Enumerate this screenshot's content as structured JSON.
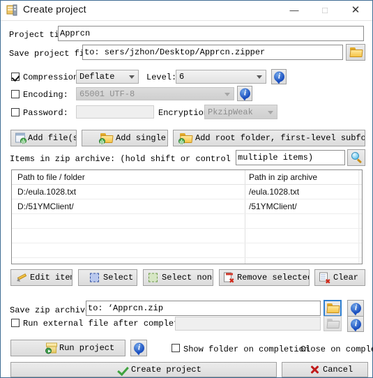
{
  "window": {
    "title": "Create project",
    "app_icon": "zip-app-icon",
    "minimize_label": "—",
    "maximize_label": "□",
    "close_label": "✕"
  },
  "project": {
    "title_label": "Project tit",
    "title_label_full": "Project title:",
    "title_value": "Apprcn",
    "save_file_label": "Save project file",
    "save_file_value": "to: sers/jzhon/Desktop/Apprcn.zipper",
    "browse_icon": "folder-icon"
  },
  "options": {
    "compression_label": "Compression:",
    "compression_checked": true,
    "compression_value": "Deflate",
    "level_label": "Level:",
    "level_value": "6",
    "encoding_label": "Encoding:",
    "encoding_checked": false,
    "encoding_value": "65001 UTF-8",
    "password_label": "Password:",
    "password_checked": false,
    "password_value": "",
    "encryption_label": "Encryption:",
    "encryption_value": "PkzipWeak",
    "info_icon": "info-icon"
  },
  "add_buttons": {
    "add_files": "Add file(s)",
    "add_single": "Add single",
    "add_root_folder": "Add root folder, first-level subfolders"
  },
  "items": {
    "label": "Items in zip archive: (hold shift or control to select",
    "filter_value": "multiple items)",
    "search_icon": "magnifier-icon",
    "columns": [
      "Path to file / folder",
      "Path in zip archive"
    ],
    "rows": [
      [
        "D:/eula.1028.txt",
        "/eula.1028.txt"
      ],
      [
        "D:/51YMClient/",
        "/51YMClient/"
      ],
      [
        "",
        ""
      ],
      [
        "",
        ""
      ],
      [
        "",
        ""
      ],
      [
        "",
        ""
      ]
    ]
  },
  "list_actions": {
    "edit_item": "Edit item",
    "select": "Select",
    "select_none": "Select none",
    "remove_selected": "Remove selected",
    "clear": "Clear"
  },
  "output": {
    "save_zip_label": "Save zip archive",
    "save_zip_value": "to: ‘Apprcn.zip",
    "run_external_label": "Run external file after completion:",
    "run_external_checked": false,
    "run_external_value": "",
    "folder_icon": "folder-icon",
    "info_icon": "info-icon"
  },
  "footer": {
    "run_project": "Run project",
    "info_icon": "info-icon",
    "show_folder_label": "Show folder on completion",
    "show_folder_checked": false,
    "close_on_completion_label": "Close on completion",
    "create_project": "Create project",
    "cancel": "Cancel"
  }
}
